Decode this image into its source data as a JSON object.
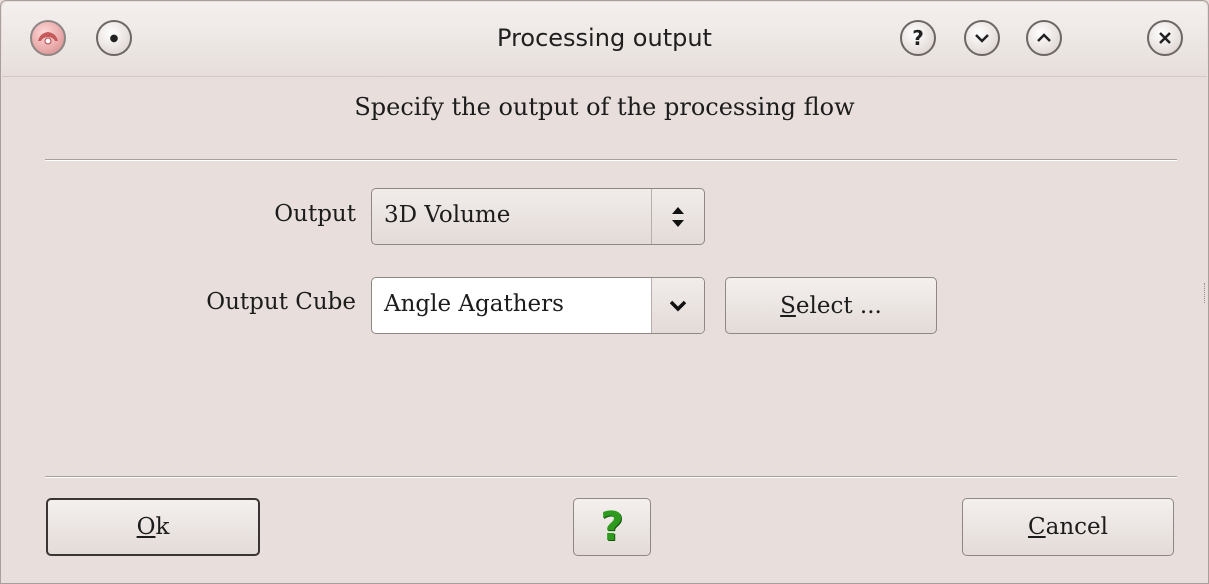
{
  "window": {
    "title": "Processing output"
  },
  "titlebar_buttons": {
    "help_glyph": "?",
    "minimize_glyph": "⌄",
    "maximize_glyph": "⌃",
    "close_glyph": "✕"
  },
  "dialog": {
    "heading": "Specify the output of the processing flow",
    "output_label": "Output",
    "output_value": "3D Volume",
    "cube_label": "Output Cube",
    "cube_value": "Angle Agathers",
    "select_button": {
      "mnemonic": "S",
      "rest": "elect ..."
    }
  },
  "buttons": {
    "ok": {
      "mnemonic": "O",
      "rest": "k"
    },
    "help": "?",
    "cancel": {
      "mnemonic": "C",
      "rest": "ancel"
    }
  },
  "colors": {
    "background": "#e8dfdc",
    "help_green": "#2e9b1f"
  }
}
